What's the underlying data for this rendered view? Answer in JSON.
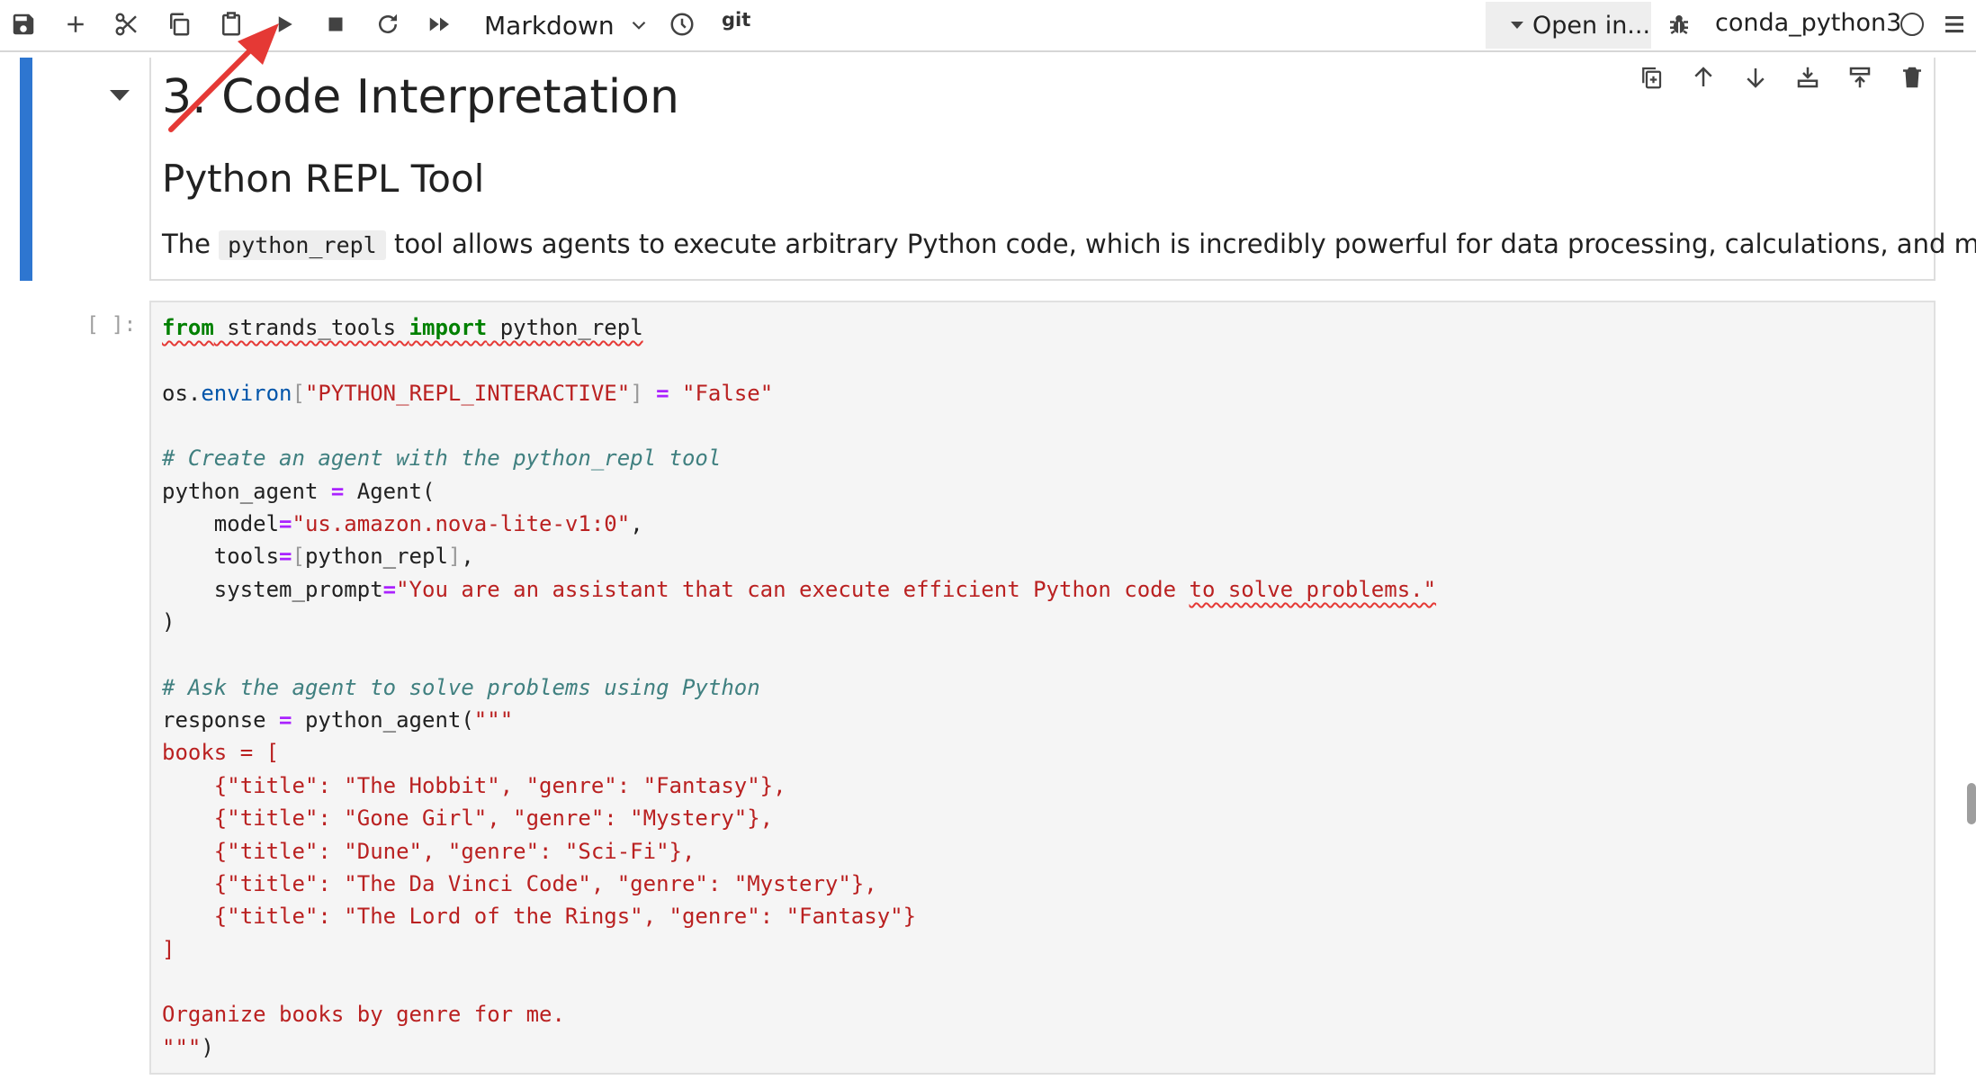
{
  "toolbar": {
    "icons": [
      "save-icon",
      "add-cell-icon",
      "cut-icon",
      "copy-icon",
      "paste-icon",
      "run-icon",
      "stop-icon",
      "restart-icon",
      "run-all-icon",
      "clock-icon",
      "bug-icon",
      "menu-icon"
    ],
    "cell_type": "Markdown",
    "git_label": "git",
    "open_in_label": "Open in...",
    "kernel_name": "conda_python3"
  },
  "markdown_cell": {
    "heading1": "3. Code Interpretation",
    "heading2": "Python REPL Tool",
    "paragraph_before": "The",
    "paragraph_code": "python_repl",
    "paragraph_after": "tool allows agents to execute arbitrary Python code, which is incredibly powerful for data processing, calculations, and more:",
    "cell_tool_icons": [
      "duplicate-cell-icon",
      "move-up-icon",
      "move-down-icon",
      "insert-below-icon",
      "split-cell-icon",
      "delete-cell-icon"
    ]
  },
  "code_cell": {
    "prompt": "[ ]:",
    "lines": {
      "l1_k1": "from",
      "l1_mod": " strands_tools ",
      "l1_k2": "import",
      "l1_name": " python_repl",
      "l3_obj": "os.",
      "l3_attr": "environ",
      "l3_b1": "[",
      "l3_key": "\"PYTHON_REPL_INTERACTIVE\"",
      "l3_b2": "]",
      "l3_eq": "=",
      "l3_val": "\"False\"",
      "l5_comment": "# Create an agent with the python_repl tool",
      "l6_var": "python_agent ",
      "l6_eq": "=",
      "l6_call": " Agent(",
      "l7_arg": "    model",
      "l7_eq": "=",
      "l7_val": "\"us.amazon.nova-lite-v1:0\"",
      "l7_end": ",",
      "l8_arg": "    tools",
      "l8_eq": "=",
      "l8_b1": "[",
      "l8_val": "python_repl",
      "l8_b2": "]",
      "l8_end": ",",
      "l9_arg": "    system_prompt",
      "l9_eq": "=",
      "l9_val1": "\"You are an assistant that can execute efficient Python code ",
      "l9_val2": "to solve problems.\"",
      "l10": ")",
      "l12_comment": "# Ask the agent to solve problems using Python",
      "l13_var": "response ",
      "l13_eq": "=",
      "l13_call": " python_agent(",
      "l13_str": "\"\"\"",
      "l14": "books = [",
      "l15": "    {\"title\": \"The Hobbit\", \"genre\": \"Fantasy\"},",
      "l16": "    {\"title\": \"Gone Girl\", \"genre\": \"Mystery\"},",
      "l17": "    {\"title\": \"Dune\", \"genre\": \"Sci-Fi\"},",
      "l18": "    {\"title\": \"The Da Vinci Code\", \"genre\": \"Mystery\"},",
      "l19": "    {\"title\": \"The Lord of the Rings\", \"genre\": \"Fantasy\"}",
      "l20": "]",
      "l22": "Organize books by genre for me.",
      "l23_str": "\"\"\"",
      "l23_end": ")"
    }
  },
  "colors": {
    "active_cell_bar": "#2e76d0",
    "keyword": "#008000",
    "string": "#ba2121",
    "comment": "#408080",
    "operator": "#aa22ff",
    "annotation_arrow": "#e53935"
  }
}
